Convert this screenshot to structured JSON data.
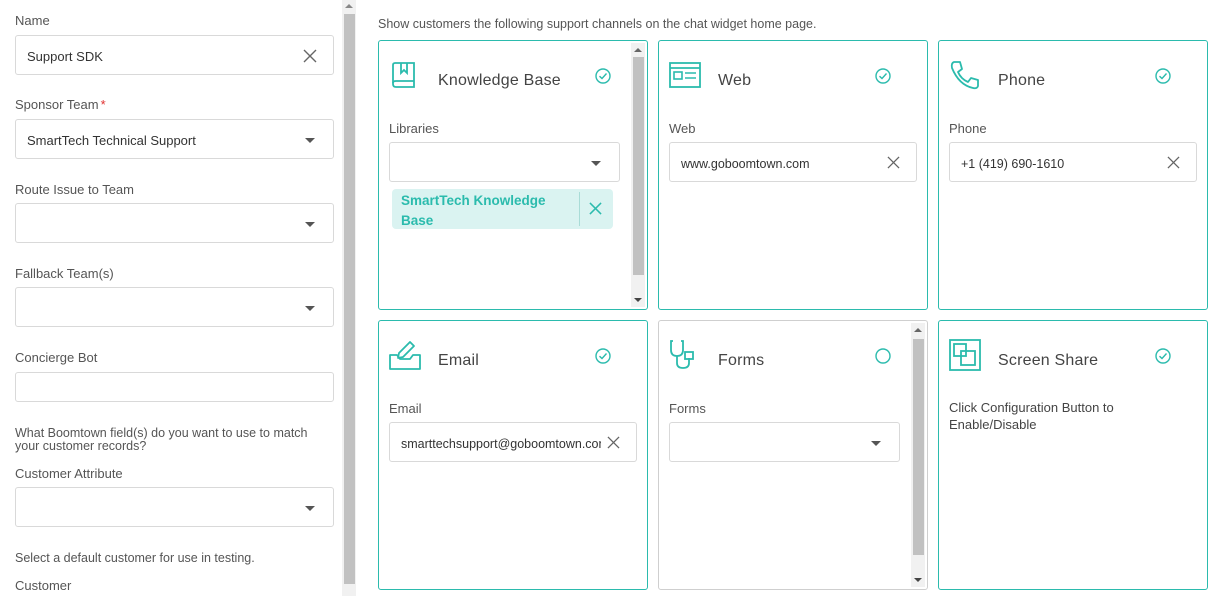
{
  "form": {
    "name_label": "Name",
    "name_value": "Support SDK",
    "sponsor_label": "Sponsor Team",
    "sponsor_required": "*",
    "sponsor_value": "SmartTech Technical Support",
    "route_label": "Route Issue to Team",
    "route_value": "",
    "fallback_label": "Fallback Team(s)",
    "fallback_value": "",
    "concierge_label": "Concierge Bot",
    "concierge_value": "",
    "match_help": "What Boomtown field(s) do you want to use to match your customer records?",
    "attribute_label": "Customer Attribute",
    "attribute_value": "",
    "default_help": "Select a default customer for use in testing.",
    "customer_label": "Customer"
  },
  "channels": {
    "intro": "Show customers the following support channels on the chat widget home page.",
    "knowledge": {
      "title": "Knowledge Base",
      "icon": "book-icon",
      "enabled": true,
      "field_label": "Libraries",
      "select_value": "",
      "chip": "SmartTech Knowledge Base"
    },
    "web": {
      "title": "Web",
      "icon": "browser-window-icon",
      "enabled": true,
      "field_label": "Web",
      "value": "www.goboomtown.com"
    },
    "phone": {
      "title": "Phone",
      "icon": "phone-icon",
      "enabled": true,
      "field_label": "Phone",
      "value": "+1 (419) 690-1610"
    },
    "email": {
      "title": "Email",
      "icon": "email-edit-icon",
      "enabled": true,
      "field_label": "Email",
      "value": "smarttechsupport@goboomtown.com"
    },
    "forms": {
      "title": "Forms",
      "icon": "stethoscope-icon",
      "enabled": false,
      "field_label": "Forms",
      "select_value": ""
    },
    "screenshare": {
      "title": "Screen Share",
      "icon": "screen-share-icon",
      "enabled": true,
      "message": "Click Configuration Button to Enable/Disable"
    }
  },
  "colors": {
    "accent": "#2bbbad",
    "chip_bg": "#daf3f1",
    "required": "#e0302f"
  }
}
